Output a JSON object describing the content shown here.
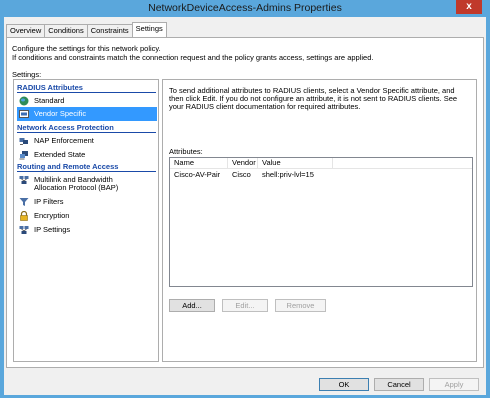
{
  "window": {
    "title": "NetworkDeviceAccess-Admins Properties",
    "close_label": "x"
  },
  "tabs": [
    {
      "label": "Overview"
    },
    {
      "label": "Conditions"
    },
    {
      "label": "Constraints"
    },
    {
      "label": "Settings"
    }
  ],
  "intro": {
    "line1": "Configure the settings for this network policy.",
    "line2": "If conditions and constraints match the connection request and the policy grants access, settings are applied."
  },
  "settings_label": "Settings:",
  "sidebar": {
    "radius_attributes": "RADIUS Attributes",
    "standard": "Standard",
    "vendor_specific": "Vendor Specific",
    "network_access_protection": "Network Access Protection",
    "nap_enforcement": "NAP Enforcement",
    "extended_state": "Extended State",
    "routing_remote_access": "Routing and Remote Access",
    "multilink_line1": "Multilink and Bandwidth",
    "multilink_line2": "Allocation Protocol (BAP)",
    "ip_filters": "IP Filters",
    "encryption": "Encryption",
    "ip_settings": "IP Settings"
  },
  "panel": {
    "desc_line1": "To send additional attributes to RADIUS clients, select a Vendor Specific attribute, and",
    "desc_line2": "then click Edit. If you do not configure an attribute, it is not sent to RADIUS clients. See",
    "desc_line3": "your RADIUS client documentation for required attributes.",
    "attributes_label": "Attributes:",
    "columns": {
      "name": "Name",
      "vendor": "Vendor",
      "value": "Value"
    },
    "rows": [
      {
        "name": "Cisco-AV-Pair",
        "vendor": "Cisco",
        "value": "shell:priv-lvl=15"
      }
    ],
    "add_button": "Add...",
    "edit_button": "Edit...",
    "remove_button": "Remove"
  },
  "footer": {
    "ok": "OK",
    "cancel": "Cancel",
    "apply": "Apply"
  }
}
